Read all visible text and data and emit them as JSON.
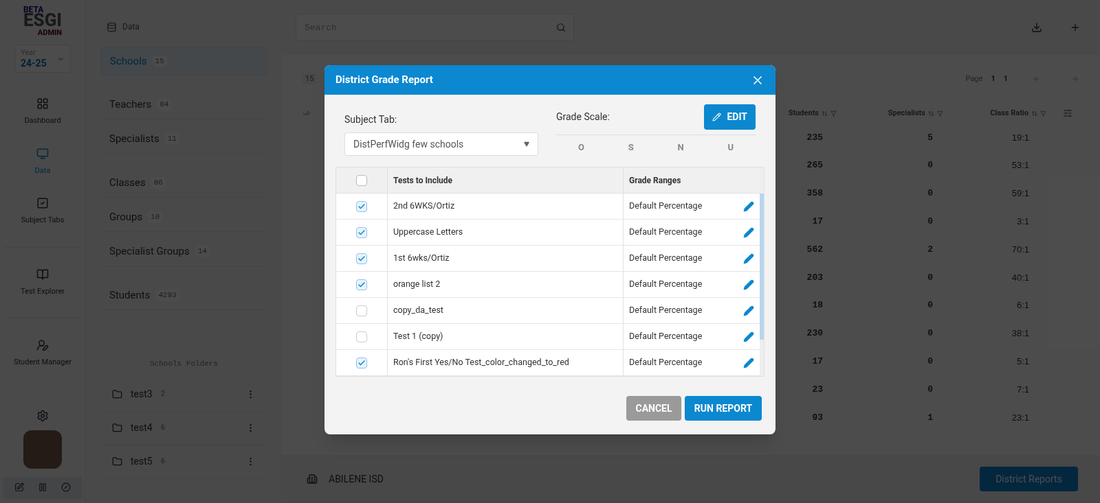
{
  "logo": {
    "beta": "BETA",
    "name": "ESGI",
    "admin": "ADMIN"
  },
  "year": {
    "label": "Year",
    "value": "24-25"
  },
  "nav": [
    {
      "label": "Dashboard",
      "selected": false
    },
    {
      "label": "Data",
      "selected": true
    },
    {
      "label": "Subject Tabs",
      "selected": false
    },
    {
      "label": "Test Explorer",
      "selected": false
    },
    {
      "label": "Student Manager",
      "selected": false
    }
  ],
  "data_panel": {
    "title": "Data",
    "items": [
      {
        "label": "Schools",
        "count": "15",
        "selected": true
      },
      {
        "label": "Teachers",
        "count": "84",
        "selected": false
      },
      {
        "label": "Specialists",
        "count": "11",
        "selected": false
      },
      {
        "label": "Classes",
        "count": "86",
        "selected": false
      },
      {
        "label": "Groups",
        "count": "10",
        "selected": false
      },
      {
        "label": "Specialist Groups",
        "count": "14",
        "selected": false
      },
      {
        "label": "Students",
        "count": "4293",
        "selected": false
      }
    ],
    "folders_title": "Schools Folders",
    "folders": [
      {
        "name": "test3",
        "count": "2"
      },
      {
        "name": "test4",
        "count": "6"
      },
      {
        "name": "test5",
        "count": "6"
      }
    ]
  },
  "search": {
    "placeholder": "Search"
  },
  "count_badge": "15",
  "pagination": {
    "label": "Page",
    "current": "1",
    "total": "1"
  },
  "table": {
    "columns": [
      "Students",
      "Specialists",
      "Class Ratio"
    ],
    "rows": [
      [
        "235",
        "5",
        "19:1"
      ],
      [
        "265",
        "0",
        "53:1"
      ],
      [
        "358",
        "0",
        "59:1"
      ],
      [
        "17",
        "0",
        "3:1"
      ],
      [
        "562",
        "2",
        "70:1"
      ],
      [
        "203",
        "0",
        "40:1"
      ],
      [
        "18",
        "0",
        "6:1"
      ],
      [
        "230",
        "0",
        "38:1"
      ],
      [
        "17",
        "0",
        "5:1"
      ],
      [
        "23",
        "0",
        "7:1"
      ],
      [
        "93",
        "1",
        "23:1"
      ]
    ]
  },
  "footer": {
    "district": "ABILENE ISD",
    "button": "District Reports"
  },
  "dialog": {
    "title": "District Grade Report",
    "subject_label": "Subject Tab:",
    "subject_value": "DistPerfWidg few schools",
    "scale_label": "Grade Scale:",
    "edit": "EDIT",
    "grades": [
      "O",
      "S",
      "N",
      "U"
    ],
    "columns": [
      "Tests to Include",
      "Grade Ranges"
    ],
    "all_checked": false,
    "tests": [
      {
        "name": "2nd 6WKS/Ortiz",
        "range": "Default Percentage",
        "checked": true
      },
      {
        "name": "Uppercase Letters",
        "range": "Default Percentage",
        "checked": true
      },
      {
        "name": "1st 6wks/Ortiz",
        "range": "Default Percentage",
        "checked": true
      },
      {
        "name": "orange list 2",
        "range": "Default Percentage",
        "checked": true
      },
      {
        "name": "copy_da_test",
        "range": "Default Percentage",
        "checked": false
      },
      {
        "name": "Test 1 (copy)",
        "range": "Default Percentage",
        "checked": false
      },
      {
        "name": "Ron's First Yes/No Test_color_changed_to_red",
        "range": "Default Percentage",
        "checked": true
      }
    ],
    "cancel": "CANCEL",
    "run": "RUN REPORT"
  }
}
